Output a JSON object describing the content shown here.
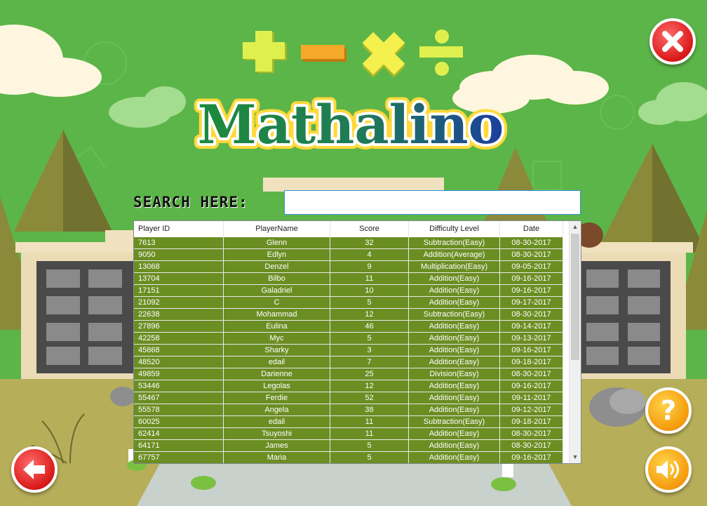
{
  "app": {
    "title": "Mathalino"
  },
  "operators": [
    "+",
    "−",
    "×",
    "÷"
  ],
  "search": {
    "label": "SEARCH HERE:",
    "value": "",
    "placeholder": ""
  },
  "table": {
    "columns": [
      "Player ID",
      "PlayerName",
      "Score",
      "Difficulty Level",
      "Date"
    ],
    "rows": [
      [
        "7613",
        "Glenn",
        "32",
        "Subtraction(Easy)",
        "08-30-2017"
      ],
      [
        "9050",
        "Edlyn",
        "4",
        "Addition(Average)",
        "08-30-2017"
      ],
      [
        "13068",
        "Denzel",
        "9",
        "Multiplication(Easy)",
        "09-05-2017"
      ],
      [
        "13704",
        "Bilbo",
        "11",
        "Addition(Easy)",
        "09-16-2017"
      ],
      [
        "17151",
        "Galadriel",
        "10",
        "Addition(Easy)",
        "09-16-2017"
      ],
      [
        "21092",
        "C",
        "5",
        "Addition(Easy)",
        "09-17-2017"
      ],
      [
        "22638",
        "Mohammad",
        "12",
        "Subtraction(Easy)",
        "08-30-2017"
      ],
      [
        "27896",
        "Eulina",
        "46",
        "Addition(Easy)",
        "09-14-2017"
      ],
      [
        "42258",
        "Myc",
        "5",
        "Addition(Easy)",
        "09-13-2017"
      ],
      [
        "45868",
        "Sharky",
        "3",
        "Addition(Easy)",
        "09-16-2017"
      ],
      [
        "48520",
        "edail",
        "7",
        "Addition(Easy)",
        "09-18-2017"
      ],
      [
        "49859",
        "Darienne",
        "25",
        "Division(Easy)",
        "08-30-2017"
      ],
      [
        "53446",
        "Legolas",
        "12",
        "Addition(Easy)",
        "09-16-2017"
      ],
      [
        "55467",
        "Ferdie",
        "52",
        "Addition(Easy)",
        "09-11-2017"
      ],
      [
        "55578",
        "Angela",
        "38",
        "Addition(Easy)",
        "09-12-2017"
      ],
      [
        "60025",
        "edail",
        "11",
        "Subtraction(Easy)",
        "09-18-2017"
      ],
      [
        "62414",
        "Tsuyoshi",
        "11",
        "Addition(Easy)",
        "08-30-2017"
      ],
      [
        "64171",
        "James",
        "5",
        "Addition(Easy)",
        "08-30-2017"
      ],
      [
        "67757",
        "Maria",
        "5",
        "Addition(Easy)",
        "09-16-2017"
      ]
    ]
  },
  "buttons": {
    "close": {
      "icon": "close-icon"
    },
    "back": {
      "icon": "back-arrow-icon"
    },
    "help": {
      "icon": "help-icon",
      "label": "?"
    },
    "sound": {
      "icon": "speaker-icon"
    }
  },
  "scrollbar": {
    "up": "▲",
    "down": "▼"
  },
  "colors": {
    "background": "#5cb548",
    "row_background": "#6b8e23",
    "title_green": "#1e8a3c",
    "title_blue": "#1c3f9e",
    "title_outline": "#ffd93b",
    "red_button": "#e22b2b",
    "orange_button": "#f5a312"
  }
}
